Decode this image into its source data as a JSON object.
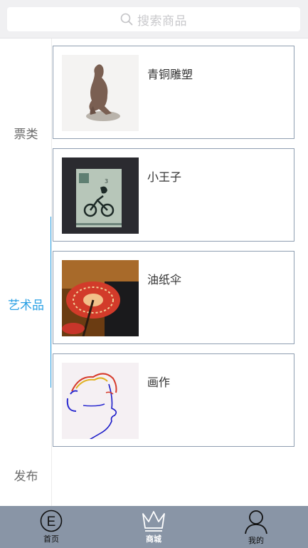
{
  "search": {
    "placeholder": "搜索商品",
    "icon": "search-icon"
  },
  "sidebar": {
    "items": [
      {
        "label": "票类",
        "active": false
      },
      {
        "label": "艺术品",
        "active": true
      },
      {
        "label": "发布",
        "active": false
      }
    ],
    "accent_color": "#2aa0e4"
  },
  "products": [
    {
      "name": "青铜雕塑",
      "image": "bronze-sculpture"
    },
    {
      "name": "小王子",
      "image": "book-cover"
    },
    {
      "name": "油纸伞",
      "image": "oil-paper-umbrella"
    },
    {
      "name": "画作",
      "image": "line-drawing"
    }
  ],
  "tabbar": {
    "bg_color": "#8995a6",
    "tabs": [
      {
        "label": "首页",
        "icon": "e-circle-icon",
        "active": false
      },
      {
        "label": "商城",
        "icon": "crown-icon",
        "active": true
      },
      {
        "label": "我的",
        "icon": "user-icon",
        "active": false
      }
    ]
  }
}
